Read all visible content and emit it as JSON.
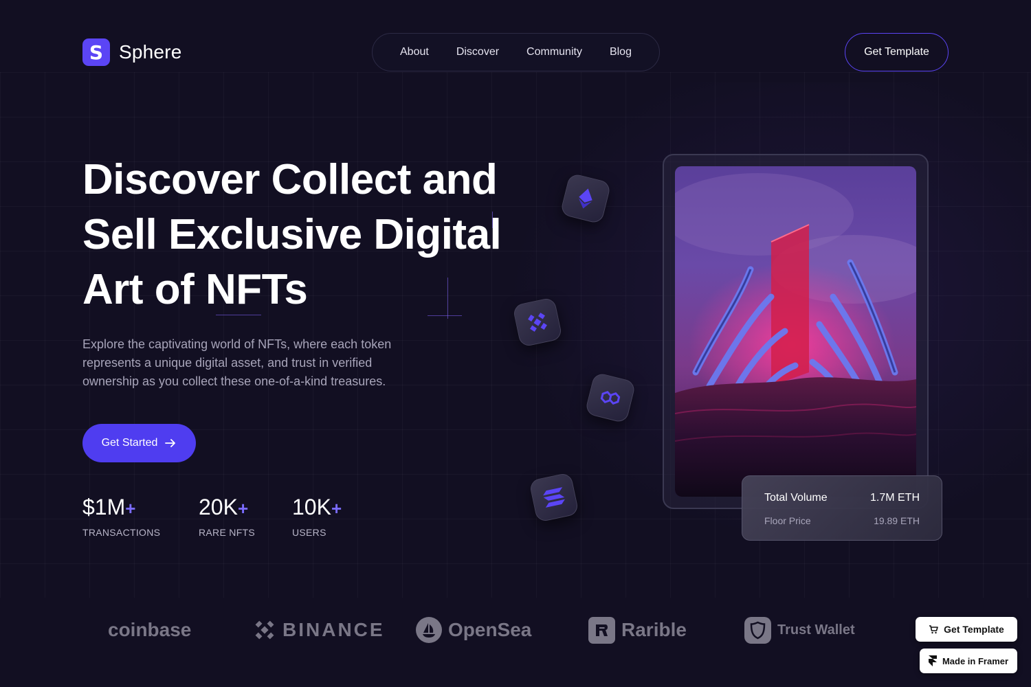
{
  "brand": {
    "name": "Sphere",
    "logo_letter": "S"
  },
  "nav": {
    "items": [
      "About",
      "Discover",
      "Community",
      "Blog"
    ]
  },
  "header": {
    "cta_label": "Get Template"
  },
  "hero": {
    "title_lines": [
      "Discover Collect and",
      "Sell Exclusive Digital",
      "Art of NFTs"
    ],
    "description": "Explore the captivating world of NFTs, where each token represents a unique digital asset, and trust in verified ownership as you collect these one-of-a-kind treasures.",
    "cta_label": "Get Started"
  },
  "stats": [
    {
      "value": "$1M",
      "suffix": "+",
      "label": "TRANSACTIONS"
    },
    {
      "value": "20K",
      "suffix": "+",
      "label": "RARE NFTS"
    },
    {
      "value": "10K",
      "suffix": "+",
      "label": "USERS"
    }
  ],
  "tokens": [
    "ethereum-icon",
    "binance-icon",
    "polygon-icon",
    "solana-icon"
  ],
  "nft_card": {
    "rows": [
      {
        "label": "Total Volume",
        "value": "1.7M ETH"
      },
      {
        "label": "Floor Price",
        "value": "19.89 ETH"
      }
    ]
  },
  "partners": [
    "coinbase",
    "BINANCE",
    "OpenSea",
    "Rarible",
    "Trust Wallet"
  ],
  "badges": {
    "get_template": "Get Template",
    "made_in_framer": "Made in Framer"
  },
  "colors": {
    "background": "#120f22",
    "accent": "#4f3df0",
    "accent_light": "#7a6bff"
  }
}
